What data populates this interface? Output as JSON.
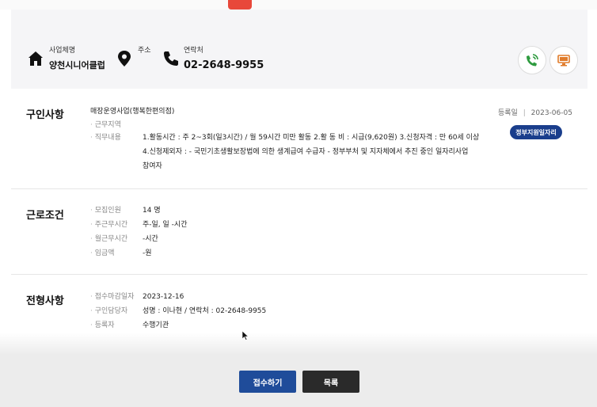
{
  "info": {
    "business_label": "사업체명",
    "business_value": "양천시니어클럽",
    "address_label": "주소",
    "contact_label": "연락처",
    "contact_value": "02-2648-9955"
  },
  "recruit": {
    "title": "구인사항",
    "reg_label": "등록일",
    "reg_date": "2023-06-05",
    "badge": "정부지원일자리",
    "rows": [
      {
        "key": "",
        "value": "매장운영사업(행복한편의점)"
      },
      {
        "key": "근무지역",
        "value": ""
      },
      {
        "key": "직무내용",
        "value": "1.활동시간 : 주 2~3회(일3시간) / 월 59시간 미만 활동   2.활 동 비 : 시급(9,620원)   3.신청자격 : 만 60세 이상"
      }
    ],
    "duty_line2": "4.신청제외자 :   - 국민기초생활보장법에 의한 생계급여 수급자   - 정부부처 및 지자체에서 추진 중인 일자리사업",
    "duty_line3": "참여자"
  },
  "conditions": {
    "title": "근로조건",
    "rows": [
      {
        "key": "모집인원",
        "value": "14 명"
      },
      {
        "key": "주근무시간",
        "value": "주-일, 일 -시간"
      },
      {
        "key": "월근무시간",
        "value": "-시간"
      },
      {
        "key": "임금액",
        "value": "-원"
      }
    ]
  },
  "screening": {
    "title": "전형사항",
    "rows": [
      {
        "key": "접수마감일자",
        "value": "2023-12-16"
      },
      {
        "key": "구인담당자",
        "value": "성명 : 이나현 / 연락처 : 02-2648-9955"
      },
      {
        "key": "등록자",
        "value": "수행기관"
      }
    ]
  },
  "buttons": {
    "apply": "접수하기",
    "list": "목록"
  },
  "colors": {
    "primary": "#1f4c9a",
    "badge": "#1a3e8c",
    "dark_button": "#2a2a2a",
    "phone_icon": "#2e9b3f",
    "monitor_icon": "#e07b2a"
  }
}
